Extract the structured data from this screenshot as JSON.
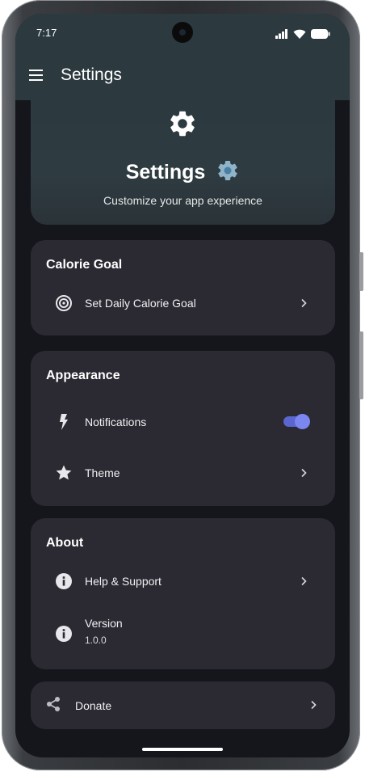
{
  "status_bar": {
    "time": "7:17"
  },
  "app_bar": {
    "title": "Settings",
    "menu_icon": "menu-icon"
  },
  "hero": {
    "icon": "gear-icon",
    "title": "Settings",
    "emoji": "gear-emoji",
    "subtitle": "Customize your app experience"
  },
  "sections": {
    "calorie_goal": {
      "title": "Calorie Goal",
      "items": [
        {
          "label": "Set Daily Calorie Goal",
          "icon": "target-icon"
        }
      ]
    },
    "appearance": {
      "title": "Appearance",
      "items": [
        {
          "label": "Notifications",
          "icon": "bolt-icon",
          "toggle_on": true
        },
        {
          "label": "Theme",
          "icon": "star-icon"
        }
      ]
    },
    "about": {
      "title": "About",
      "items": [
        {
          "label": "Help & Support",
          "icon": "info-icon"
        },
        {
          "label": "Version",
          "value": "1.0.0",
          "icon": "info-icon"
        }
      ]
    },
    "donate": {
      "label": "Donate",
      "icon": "share-icon"
    }
  },
  "colors": {
    "app_bar": "#2c3a40",
    "background": "#14161c",
    "card": "#2b2932",
    "toggle_accent": "#5c66d0"
  }
}
